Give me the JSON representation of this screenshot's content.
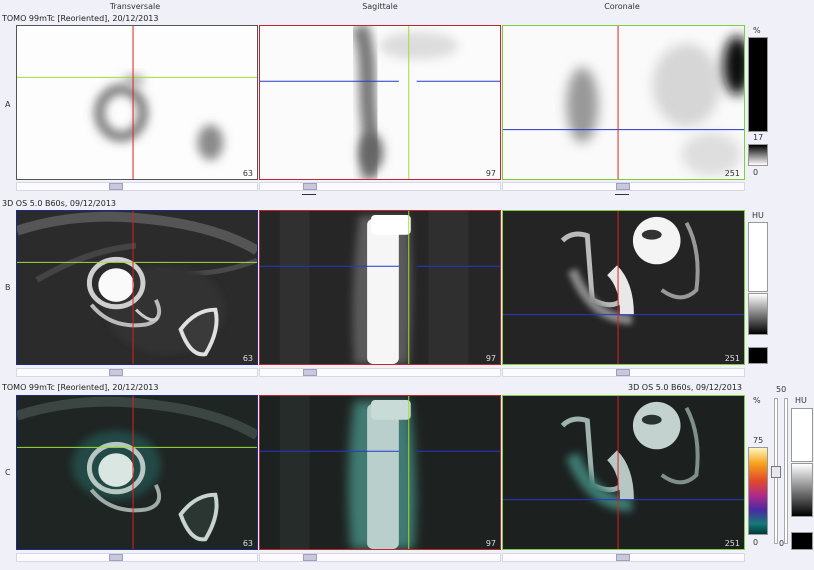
{
  "columns": {
    "transverse": "Transversale",
    "sagittal": "Sagittale",
    "coronal": "Coronale"
  },
  "rows": [
    {
      "label": "A",
      "series": "TOMO 99mTc [Reoriented], 20/12/2013"
    },
    {
      "label": "B",
      "series": "3D  OS  5.0  B60s, 09/12/2013"
    },
    {
      "label": "C",
      "series": "TOMO 99mTc [Reoriented], 20/12/2013",
      "series_right": "3D  OS  5.0  B60s, 09/12/2013"
    }
  ],
  "slices": {
    "transverse": "63",
    "sagittal": "97",
    "coronal": "251"
  },
  "scales": {
    "a": {
      "unit": "%",
      "max": "17",
      "min": "0"
    },
    "b": {
      "unit": "HU"
    },
    "c_spect": {
      "unit": "%",
      "top": "50",
      "max": "75",
      "min": "0",
      "bottom": "0"
    },
    "c_ct": {
      "unit": "HU"
    }
  },
  "colors": {
    "transverse_frame": "#1a2b8a",
    "sagittal_frame": "#c0272d",
    "coronal_frame": "#7ccf3c",
    "crosshair_red": "#e02020",
    "crosshair_green": "#9adf3a",
    "crosshair_blue": "#2338c8"
  }
}
